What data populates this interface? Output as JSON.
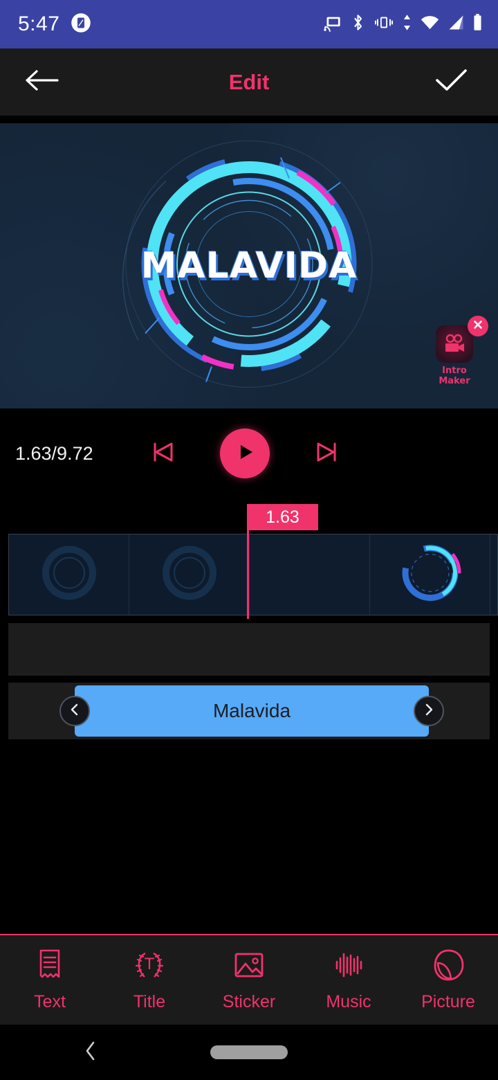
{
  "statusbar": {
    "time": "5:47",
    "left_icons": [
      {
        "name": "screenshot-icon"
      }
    ],
    "right_icons": [
      {
        "name": "cast-icon"
      },
      {
        "name": "bluetooth-icon"
      },
      {
        "name": "vibrate-icon"
      },
      {
        "name": "data-transfer-icon"
      },
      {
        "name": "wifi-icon"
      },
      {
        "name": "cellular-signal-icon"
      },
      {
        "name": "battery-icon"
      }
    ],
    "background_color": "#3a43a4"
  },
  "appbar": {
    "back_icon": "arrow-left-icon",
    "title": "Edit",
    "confirm_icon": "check-icon",
    "title_color": "#f0336b",
    "background_color": "#1b1b1b"
  },
  "preview": {
    "title_text": "MALAVIDA",
    "background_color": "#152639",
    "watermark": {
      "label": "Intro Maker",
      "icon": "movie-camera-icon",
      "close_icon": "close-icon",
      "accent_color": "#f0336b"
    }
  },
  "transport": {
    "time_display": "1.63/9.72",
    "current_time": "1.63",
    "total_time": "9.72",
    "prev_icon": "skip-previous-icon",
    "play_icon": "play-icon",
    "next_icon": "skip-next-icon",
    "accent_color": "#f0336b"
  },
  "timeline": {
    "playhead_badge": "1.63",
    "playhead_color": "#f0336b",
    "frames": [
      {
        "style": "dim"
      },
      {
        "style": "dim"
      },
      {
        "style": "ring"
      },
      {
        "style": "ring"
      },
      {
        "style": "ring"
      }
    ],
    "text_track": {
      "clip_label": "Malavida",
      "clip_color": "#56aaf7",
      "left_handle_icon": "chevron-left-icon",
      "right_handle_icon": "chevron-right-icon"
    }
  },
  "toolbar": {
    "accent_color": "#f0336b",
    "items": [
      {
        "label": "Text",
        "icon": "text-lines-icon"
      },
      {
        "label": "Title",
        "icon": "laurel-title-icon"
      },
      {
        "label": "Sticker",
        "icon": "image-icon"
      },
      {
        "label": "Music",
        "icon": "waveform-icon"
      },
      {
        "label": "Picture",
        "icon": "picture-shape-icon"
      }
    ]
  },
  "navbar": {
    "back_icon": "nav-back-icon",
    "home_pill": "nav-home-pill"
  }
}
